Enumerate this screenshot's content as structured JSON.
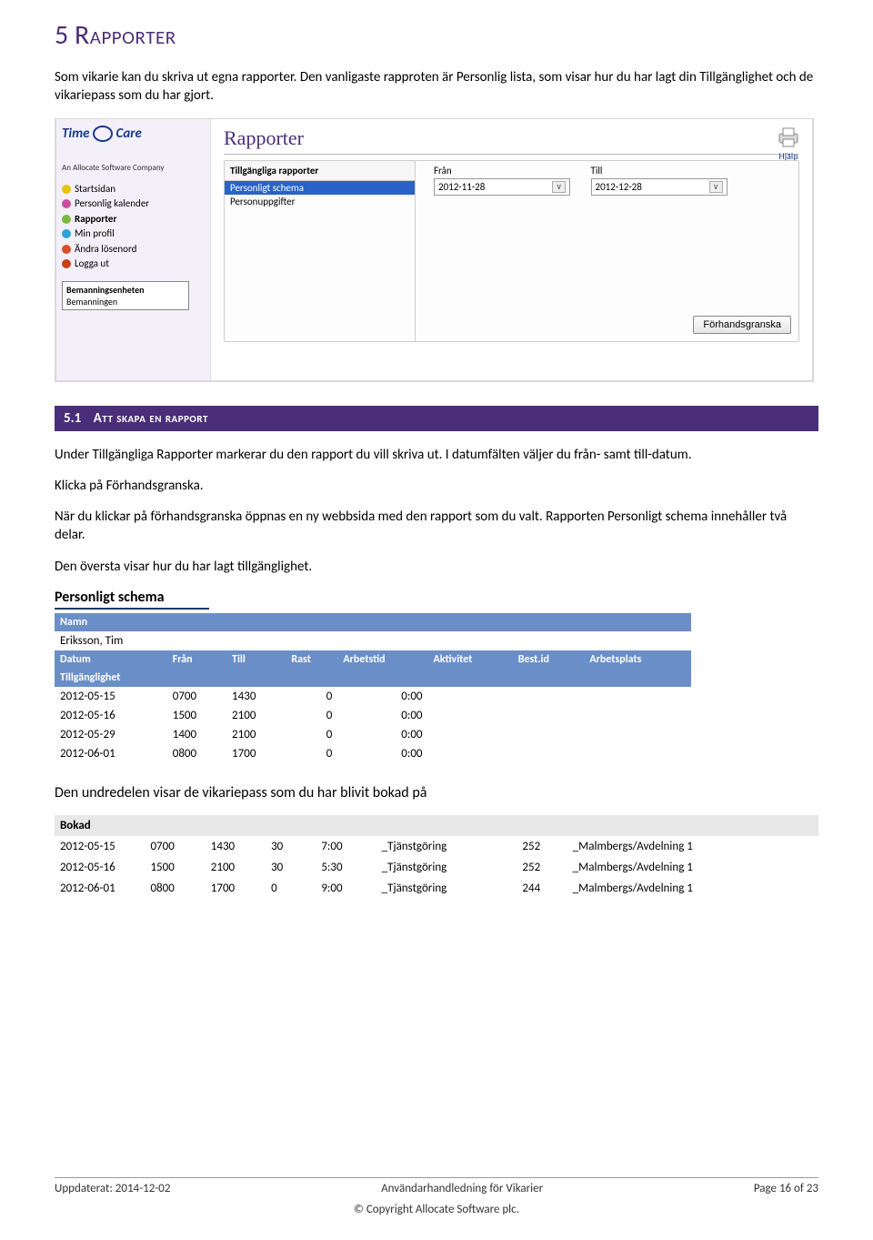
{
  "heading": {
    "number": "5",
    "title": "Rapporter"
  },
  "intro": "Som vikarie kan du skriva ut egna rapporter. Den vanligaste rapproten är Personlig lista, som visar hur du har lagt din Tillgänglighet och de vikariepass som du har gjort.",
  "screenshot1": {
    "logoName": "Time",
    "logoName2": "Care",
    "logoSubtitle": "An Allocate Software Company",
    "nav": [
      {
        "label": "Startsidan",
        "color": "#e8c400"
      },
      {
        "label": "Personlig kalender",
        "color": "#c94f9e"
      },
      {
        "label": "Rapporter",
        "color": "#7fb83f",
        "bold": true
      },
      {
        "label": "Min profil",
        "color": "#2aa5d9"
      },
      {
        "label": "Ändra lösenord",
        "color": "#d94f2a"
      },
      {
        "label": "Logga ut",
        "color": "#c9401a"
      }
    ],
    "boxTitle": "Bemanningsenheten",
    "boxSub": "Bemanningen",
    "mainTitle": "Rapporter",
    "panelHead": "Tillgängliga rapporter",
    "listItems": [
      {
        "label": "Personligt schema",
        "selected": true
      },
      {
        "label": "Personuppgifter",
        "selected": false
      }
    ],
    "fromLabel": "Från",
    "tillLabel": "Till",
    "fromValue": "2012-11-28",
    "tillValue": "2012-12-28",
    "previewBtn": "Förhandsgranska",
    "helpLabel": "Hjälp"
  },
  "section": {
    "number": "5.1",
    "title": "Att skapa en rapport"
  },
  "para1": "Under Tillgängliga Rapporter markerar du den rapport du vill skriva ut. I datumfälten väljer du från- samt till-datum.",
  "para2": "Klicka på Förhandsgranska.",
  "para3": "När du klickar på förhandsgranska öppnas en ny webbsida med den rapport som du valt. Rapporten Personligt schema innehåller två delar.",
  "para4": "Den översta visar hur du har lagt tillgänglighet.",
  "table1": {
    "title": "Personligt schema",
    "nameHeader": "Namn",
    "name": "Eriksson, Tim",
    "cols": [
      "Datum",
      "Från",
      "Till",
      "Rast",
      "Arbetstid",
      "Aktivitet",
      "Best.id",
      "Arbetsplats"
    ],
    "subhead": "Tillgänglighet",
    "rows": [
      [
        "2012-05-15",
        "0700",
        "1430",
        "0",
        "0:00"
      ],
      [
        "2012-05-16",
        "1500",
        "2100",
        "0",
        "0:00"
      ],
      [
        "2012-05-29",
        "1400",
        "2100",
        "0",
        "0:00"
      ],
      [
        "2012-06-01",
        "0800",
        "1700",
        "0",
        "0:00"
      ]
    ]
  },
  "para5": "Den undredelen visar de vikariepass som du har blivit bokad på",
  "table2": {
    "head": "Bokad",
    "rows": [
      [
        "2012-05-15",
        "0700",
        "1430",
        "30",
        "7:00",
        "_Tjänstgöring",
        "252",
        "_Malmbergs/Avdelning 1"
      ],
      [
        "2012-05-16",
        "1500",
        "2100",
        "30",
        "5:30",
        "_Tjänstgöring",
        "252",
        "_Malmbergs/Avdelning 1"
      ],
      [
        "2012-06-01",
        "0800",
        "1700",
        "0",
        "9:00",
        "_Tjänstgöring",
        "244",
        "_Malmbergs/Avdelning 1"
      ]
    ]
  },
  "footer": {
    "left": "Uppdaterat: 2014-12-02",
    "center": "Användarhandledning för Vikarier",
    "right": "Page 16 of 23",
    "copy": "© Copyright Allocate Software plc."
  }
}
